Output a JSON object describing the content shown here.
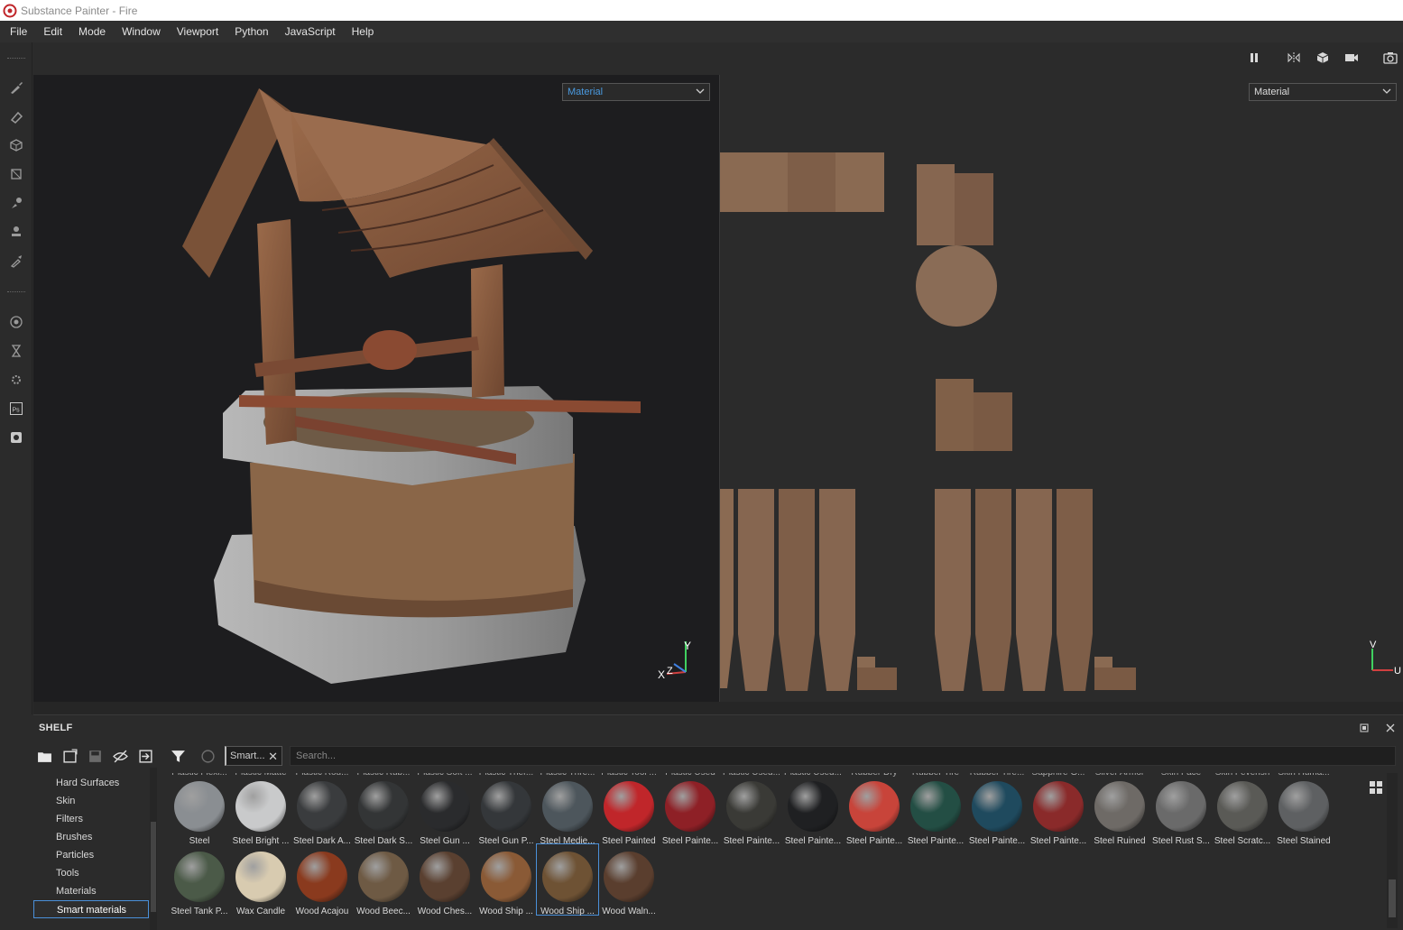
{
  "window": {
    "title": "Substance Painter - Fire"
  },
  "menu": [
    "File",
    "Edit",
    "Mode",
    "Window",
    "Viewport",
    "Python",
    "JavaScript",
    "Help"
  ],
  "left_tools": [
    "paint-brush-icon",
    "eraser-icon",
    "projection-icon",
    "polygon-fill-icon",
    "smudge-icon",
    "clone-stamp-icon",
    "color-picker-icon",
    "bake-icon",
    "timer-icon",
    "settings-icon",
    "photoshop-icon",
    "export-icon"
  ],
  "viewport3d": {
    "channel_select": "Material",
    "axis": {
      "y": "Y",
      "x": "X",
      "z": "Z"
    }
  },
  "viewport2d": {
    "channel_select": "Material",
    "axis": {
      "v": "V",
      "u": "U"
    }
  },
  "shelf": {
    "title": "SHELF",
    "filter_chip": "Smart...",
    "search_placeholder": "Search...",
    "categories": [
      "Hard Surfaces",
      "Skin",
      "Filters",
      "Brushes",
      "Particles",
      "Tools",
      "Materials",
      "Smart materials"
    ],
    "active_category": "Smart materials",
    "cut_labels": [
      "Plastic Flexi...",
      "Plastic Matte",
      "Plastic Rou...",
      "Plastic Rub...",
      "Plastic Soft ...",
      "Plastic Ther...",
      "Plastic Thre...",
      "Plastic Tool ...",
      "Plastic Used",
      "Plastic Used...",
      "Plastic Used...",
      "Rubber Dry",
      "Rubber Tire",
      "Rubber Tire...",
      "Sapphire G...",
      "Silver Armor",
      "Skin Face",
      "Skin Feverish",
      "Skin Huma..."
    ],
    "materials_row1": [
      {
        "label": "Steel",
        "color": "#8a8e92"
      },
      {
        "label": "Steel Bright ...",
        "color": "#c9cacb"
      },
      {
        "label": "Steel Dark A...",
        "color": "#3a3c3e"
      },
      {
        "label": "Steel Dark S...",
        "color": "#333536"
      },
      {
        "label": "Steel Gun ...",
        "color": "#2a2b2d"
      },
      {
        "label": "Steel Gun P...",
        "color": "#34373a"
      },
      {
        "label": "Steel Medie...",
        "color": "#4d565c"
      },
      {
        "label": "Steel Painted",
        "color": "#c0262a"
      },
      {
        "label": "Steel Painte...",
        "color": "#8e2026"
      },
      {
        "label": "Steel Painte...",
        "color": "#3a3a36"
      },
      {
        "label": "Steel Painte...",
        "color": "#1f2022"
      },
      {
        "label": "Steel Painte...",
        "color": "#c8443a"
      },
      {
        "label": "Steel Painte...",
        "color": "#234e44"
      },
      {
        "label": "Steel Painte...",
        "color": "#1f4a5e"
      },
      {
        "label": "Steel Painte...",
        "color": "#8a2a2a"
      },
      {
        "label": "Steel Ruined",
        "color": "#6e6a66"
      },
      {
        "label": "Steel Rust S...",
        "color": "#6a6a6a"
      },
      {
        "label": "Steel Scratc...",
        "color": "#5a5a56"
      },
      {
        "label": "Steel Stained",
        "color": "#5e6062"
      }
    ],
    "materials_row2": [
      {
        "label": "Steel Tank P...",
        "color": "#4b5a48"
      },
      {
        "label": "Wax Candle",
        "color": "#d8cbb0"
      },
      {
        "label": "Wood Acajou",
        "color": "#8a3a1e"
      },
      {
        "label": "Wood Beec...",
        "color": "#6e5a44"
      },
      {
        "label": "Wood Ches...",
        "color": "#5a4030"
      },
      {
        "label": "Wood Ship ...",
        "color": "#8a5a36"
      },
      {
        "label": "Wood Ship ...",
        "color": "#6e5234"
      },
      {
        "label": "Wood Waln...",
        "color": "#5a3e2e"
      }
    ],
    "selected_material": "Wood Ship ..."
  }
}
